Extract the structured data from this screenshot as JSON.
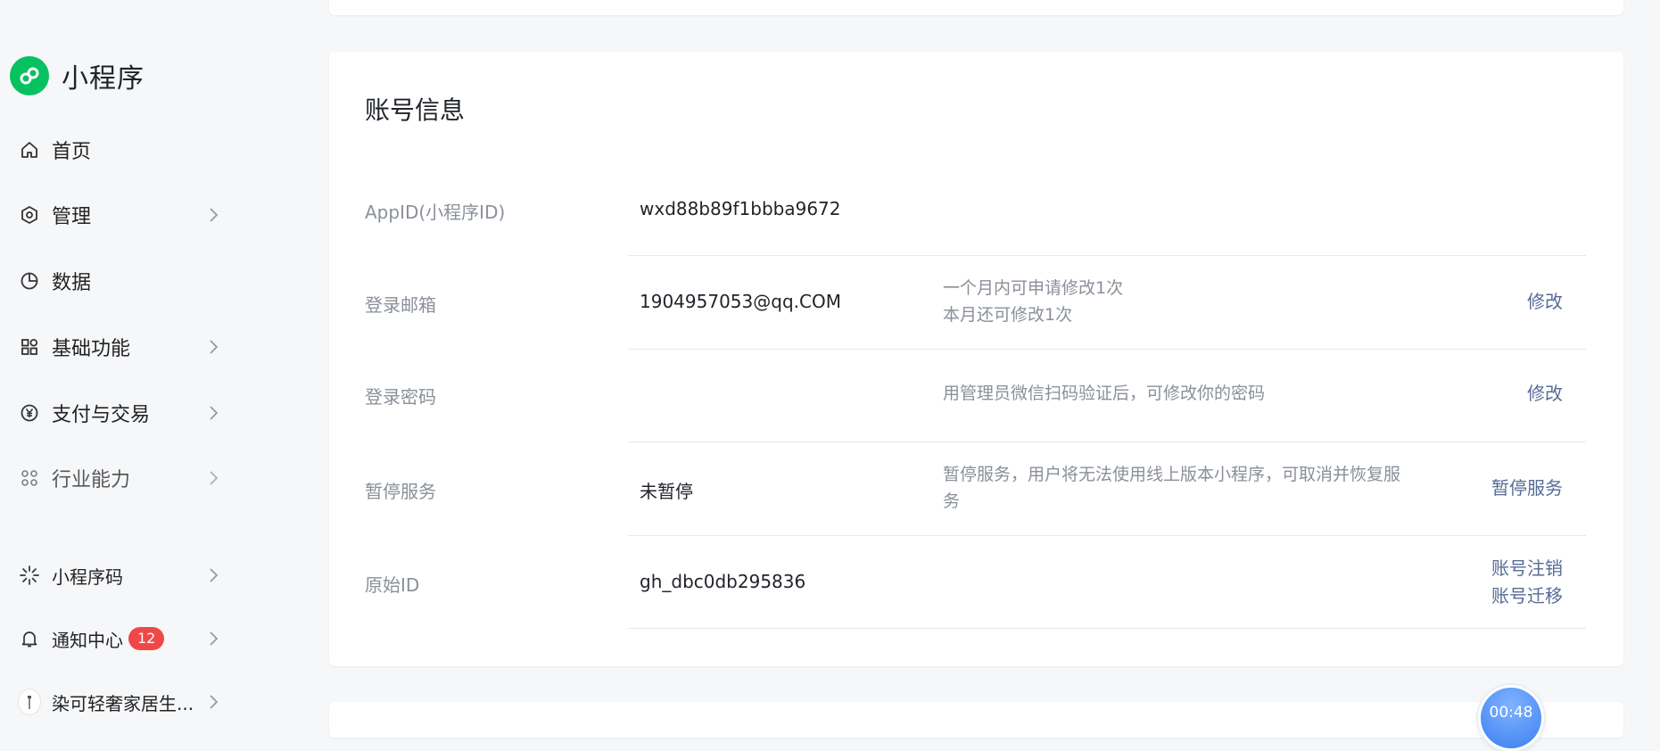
{
  "brand": {
    "name": "小程序"
  },
  "sidebar": {
    "items": [
      {
        "label": "首页"
      },
      {
        "label": "管理"
      },
      {
        "label": "数据"
      },
      {
        "label": "基础功能"
      },
      {
        "label": "支付与交易"
      },
      {
        "label": "行业能力"
      }
    ],
    "bottom": [
      {
        "label": "小程序码"
      },
      {
        "label": "通知中心",
        "badge": "12"
      },
      {
        "label": "染可轻奢家居生..."
      }
    ]
  },
  "account": {
    "title": "账号信息",
    "rows": [
      {
        "label": "AppID(小程序ID)",
        "value": "wxd88b89f1bbba9672"
      },
      {
        "label": "登录邮箱",
        "value": "1904957053@qq.COM",
        "desc_1": "一个月内可申请修改1次",
        "desc_2": "本月还可修改1次",
        "action": "修改"
      },
      {
        "label": "登录密码",
        "desc": "用管理员微信扫码验证后，可修改你的密码",
        "action": "修改"
      },
      {
        "label": "暂停服务",
        "value": "未暂停",
        "desc": "暂停服务，用户将无法使用线上版本小程序，可取消并恢复服务",
        "action": "暂停服务"
      },
      {
        "label": "原始ID",
        "value": "gh_dbc0db295836",
        "action_1": "账号注销",
        "action_2": "账号迁移"
      }
    ]
  },
  "timer": {
    "text": "00:48"
  },
  "colors": {
    "brand": "#07c160",
    "link": "#576b95",
    "badge": "#f04848"
  }
}
